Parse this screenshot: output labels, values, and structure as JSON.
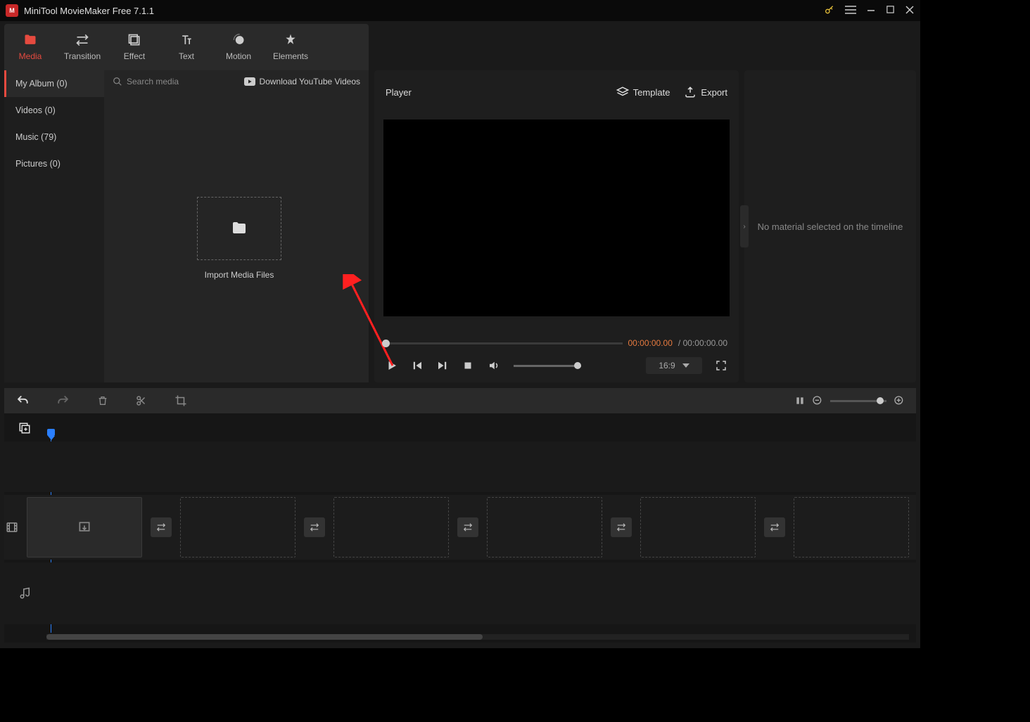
{
  "titlebar": {
    "title": "MiniTool MovieMaker Free 7.1.1"
  },
  "tabs": [
    {
      "label": "Media",
      "icon": "folder"
    },
    {
      "label": "Transition",
      "icon": "swap"
    },
    {
      "label": "Effect",
      "icon": "layers"
    },
    {
      "label": "Text",
      "icon": "text"
    },
    {
      "label": "Motion",
      "icon": "circle"
    },
    {
      "label": "Elements",
      "icon": "sparkle"
    }
  ],
  "sidebar": [
    {
      "label": "My Album (0)"
    },
    {
      "label": "Videos (0)"
    },
    {
      "label": "Music (79)"
    },
    {
      "label": "Pictures (0)"
    }
  ],
  "search": {
    "placeholder": "Search media"
  },
  "yt_download": "Download YouTube Videos",
  "import_label": "Import Media Files",
  "player": {
    "title": "Player",
    "template": "Template",
    "export": "Export",
    "time_current": "00:00:00.00",
    "time_separator": "/",
    "time_total": "00:00:00.00",
    "aspect": "16:9"
  },
  "rightpanel": {
    "message": "No material selected on the timeline"
  }
}
